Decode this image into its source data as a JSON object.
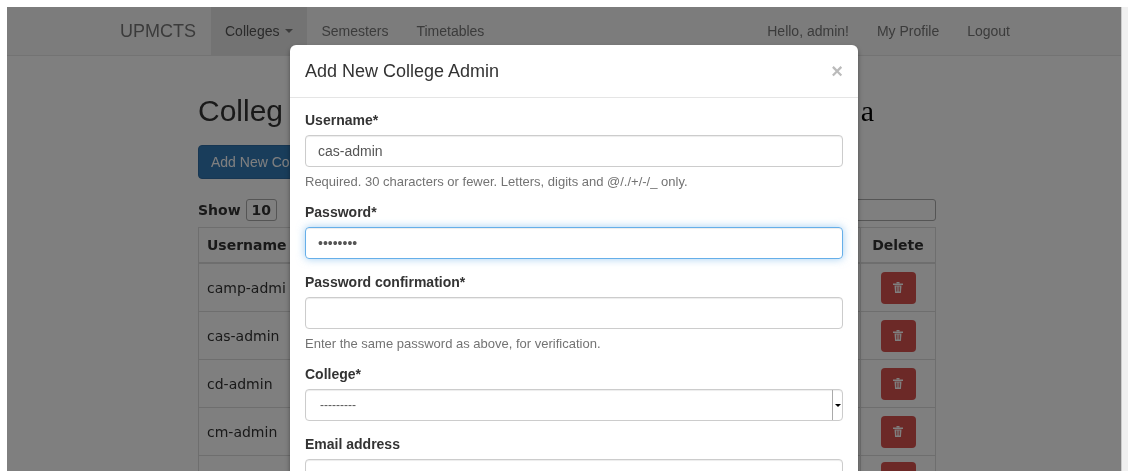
{
  "navbar": {
    "brand": "UPMCTS",
    "items": [
      {
        "label": "Colleges",
        "dropdown": true,
        "selected": true
      },
      {
        "label": "Semesters",
        "dropdown": false,
        "selected": false
      },
      {
        "label": "Timetables",
        "dropdown": false,
        "selected": false
      }
    ],
    "right_items": [
      "Hello, admin!",
      "My Profile",
      "Logout"
    ]
  },
  "page": {
    "heading": "Colleg",
    "heading_tail": "a",
    "add_button": "Add New Co",
    "show_label": "Show",
    "page_size": "10",
    "table": {
      "columns": [
        "Username",
        "Delete"
      ],
      "rows": [
        {
          "username": "camp-admi"
        },
        {
          "username": "cas-admin"
        },
        {
          "username": "cd-admin"
        },
        {
          "username": "cm-admin"
        },
        {}
      ]
    }
  },
  "modal": {
    "title": "Add New College Admin",
    "close": "×",
    "fields": [
      {
        "kind": "text",
        "label": "Username*",
        "value": "cas-admin",
        "focused": false,
        "help": "Required. 30 characters or fewer. Letters, digits and @/./+/-/_ only."
      },
      {
        "kind": "text",
        "label": "Password*",
        "value": "••••••••",
        "focused": true
      },
      {
        "kind": "text",
        "label": "Password confirmation*",
        "focused": false,
        "help": "Enter the same password as above, for verification."
      },
      {
        "kind": "select",
        "label": "College*",
        "value": "---------",
        "focused": false
      },
      {
        "kind": "text",
        "label": "Email address",
        "focused": false
      }
    ]
  }
}
